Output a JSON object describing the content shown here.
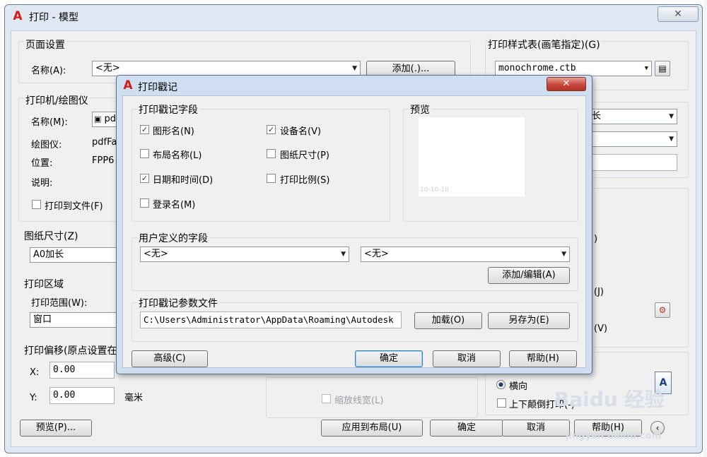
{
  "main_window": {
    "title": "打印 - 模型",
    "close_glyph": "✕",
    "page_setup": {
      "title": "页面设置",
      "name_label": "名称(A):",
      "name_value": "<无>",
      "add_button": "添加(.)..."
    },
    "printer": {
      "title": "打印机/绘图仪",
      "name_label": "名称(M):",
      "name_value": "pdfFa",
      "plotter_label": "绘图仪:",
      "plotter_value": "pdfFa",
      "location_label": "位置:",
      "location_value": "FPP6",
      "description_label": "说明:",
      "print_to_file": "打印到文件(F)"
    },
    "paper_size": {
      "title": "图纸尺寸(Z)",
      "value": "A0加长"
    },
    "plot_area": {
      "title": "打印区域",
      "range_label": "打印范围(W):",
      "range_value": "窗口"
    },
    "plot_offset": {
      "title": "打印偏移(原点设置在",
      "x_label": "X:",
      "x_value": "0.00",
      "y_label": "Y:",
      "y_value": "0.00",
      "unit": "毫米"
    },
    "plot_style_table": {
      "title": "打印样式表(画笔指定)(G)",
      "value": "monochrome.ctb"
    },
    "right_partial": {
      "combo1_text": "长",
      "paren_d": ")",
      "paren_j": "(J)",
      "paren_v": "(V)"
    },
    "orientation": {
      "landscape": "横向",
      "upside_down": "上下颠倒打印(-)"
    },
    "scale_lineweights": "缩放线宽(L)",
    "buttons": {
      "preview": "预览(P)...",
      "apply_to_layout": "应用到布局(U)",
      "ok": "确定",
      "cancel": "取消",
      "help": "帮助(H)"
    },
    "watermark": {
      "line1": "Baidu 经验",
      "line2": "jingyan.baidu.com"
    }
  },
  "stamp_dialog": {
    "title": "打印戳记",
    "close_glyph": "✕",
    "fields_group": {
      "title": "打印戳记字段",
      "items": [
        {
          "label": "图形名(N)",
          "checked": true
        },
        {
          "label": "设备名(V)",
          "checked": true
        },
        {
          "label": "布局名称(L)",
          "checked": false
        },
        {
          "label": "图纸尺寸(P)",
          "checked": false
        },
        {
          "label": "日期和时间(D)",
          "checked": true
        },
        {
          "label": "打印比例(S)",
          "checked": false
        },
        {
          "label": "登录名(M)",
          "checked": false
        }
      ],
      "check_glyph": "✓"
    },
    "preview_group": {
      "title": "预览",
      "sample_text": "10-10-10"
    },
    "user_fields_group": {
      "title": "用户定义的字段",
      "field1": "<无>",
      "field2": "<无>",
      "add_edit_button": "添加/编辑(A)"
    },
    "param_file_group": {
      "title": "打印戳记参数文件",
      "path": "C:\\Users\\Administrator\\AppData\\Roaming\\Autodesk",
      "load_button": "加载(O)",
      "save_as_button": "另存为(E)"
    },
    "buttons": {
      "advanced": "高级(C)",
      "ok": "确定",
      "cancel": "取消",
      "help": "帮助(H)"
    }
  }
}
